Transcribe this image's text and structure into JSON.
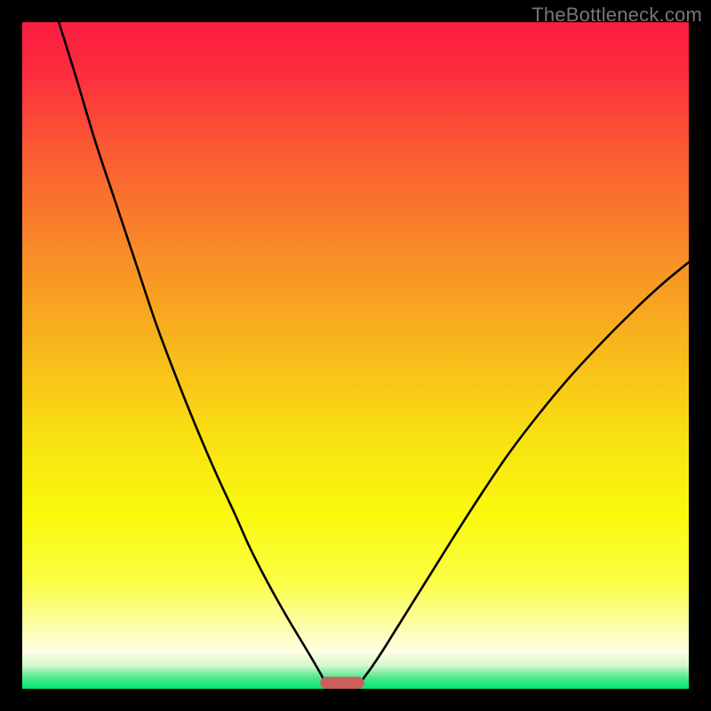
{
  "watermark": "TheBottleneck.com",
  "chart_data": {
    "type": "line",
    "title": "",
    "xlabel": "",
    "ylabel": "",
    "xlim": [
      0,
      100
    ],
    "ylim": [
      0,
      100
    ],
    "background_gradient": {
      "stops": [
        {
          "offset": 0.0,
          "color": "#fb1d42"
        },
        {
          "offset": 0.07,
          "color": "#fc2b3e"
        },
        {
          "offset": 0.2,
          "color": "#fa5d32"
        },
        {
          "offset": 0.35,
          "color": "#f88d27"
        },
        {
          "offset": 0.5,
          "color": "#f8bb1b"
        },
        {
          "offset": 0.62,
          "color": "#f8e012"
        },
        {
          "offset": 0.74,
          "color": "#fafa0d"
        },
        {
          "offset": 0.84,
          "color": "#fbfd46"
        },
        {
          "offset": 0.905,
          "color": "#fdfea8"
        },
        {
          "offset": 0.945,
          "color": "#fefee6"
        },
        {
          "offset": 0.965,
          "color": "#d3f8cd"
        },
        {
          "offset": 0.982,
          "color": "#57e991"
        },
        {
          "offset": 1.0,
          "color": "#00e670"
        }
      ]
    },
    "series": [
      {
        "name": "left-curve",
        "stroke": "#000000",
        "x": [
          5.5,
          8,
          11,
          14,
          17,
          20,
          23,
          26,
          29,
          32,
          34,
          36,
          38,
          40,
          41.5,
          43,
          44,
          44.8,
          45.4,
          45.8,
          46.0
        ],
        "y": [
          100,
          92,
          82,
          73,
          64,
          55,
          47,
          39.5,
          32.5,
          26,
          21.5,
          17.5,
          13.8,
          10.3,
          7.8,
          5.3,
          3.6,
          2.2,
          1.1,
          0.35,
          0.0
        ]
      },
      {
        "name": "right-curve",
        "stroke": "#000000",
        "x": [
          50.0,
          50.5,
          51.3,
          52.4,
          54,
          56,
          58.5,
          61.5,
          65,
          69,
          73,
          77.5,
          82,
          87,
          92,
          96,
          100
        ],
        "y": [
          0.0,
          0.6,
          1.7,
          3.2,
          5.6,
          8.8,
          12.8,
          17.6,
          23.2,
          29.4,
          35.3,
          41.2,
          46.6,
          52.0,
          57.0,
          60.7,
          64.0
        ]
      }
    ],
    "marker": {
      "name": "bottom-marker",
      "cx": 48.0,
      "cy": 0.0,
      "rx": 3.3,
      "ry": 0.9,
      "fill": "#cb5f5b"
    }
  }
}
